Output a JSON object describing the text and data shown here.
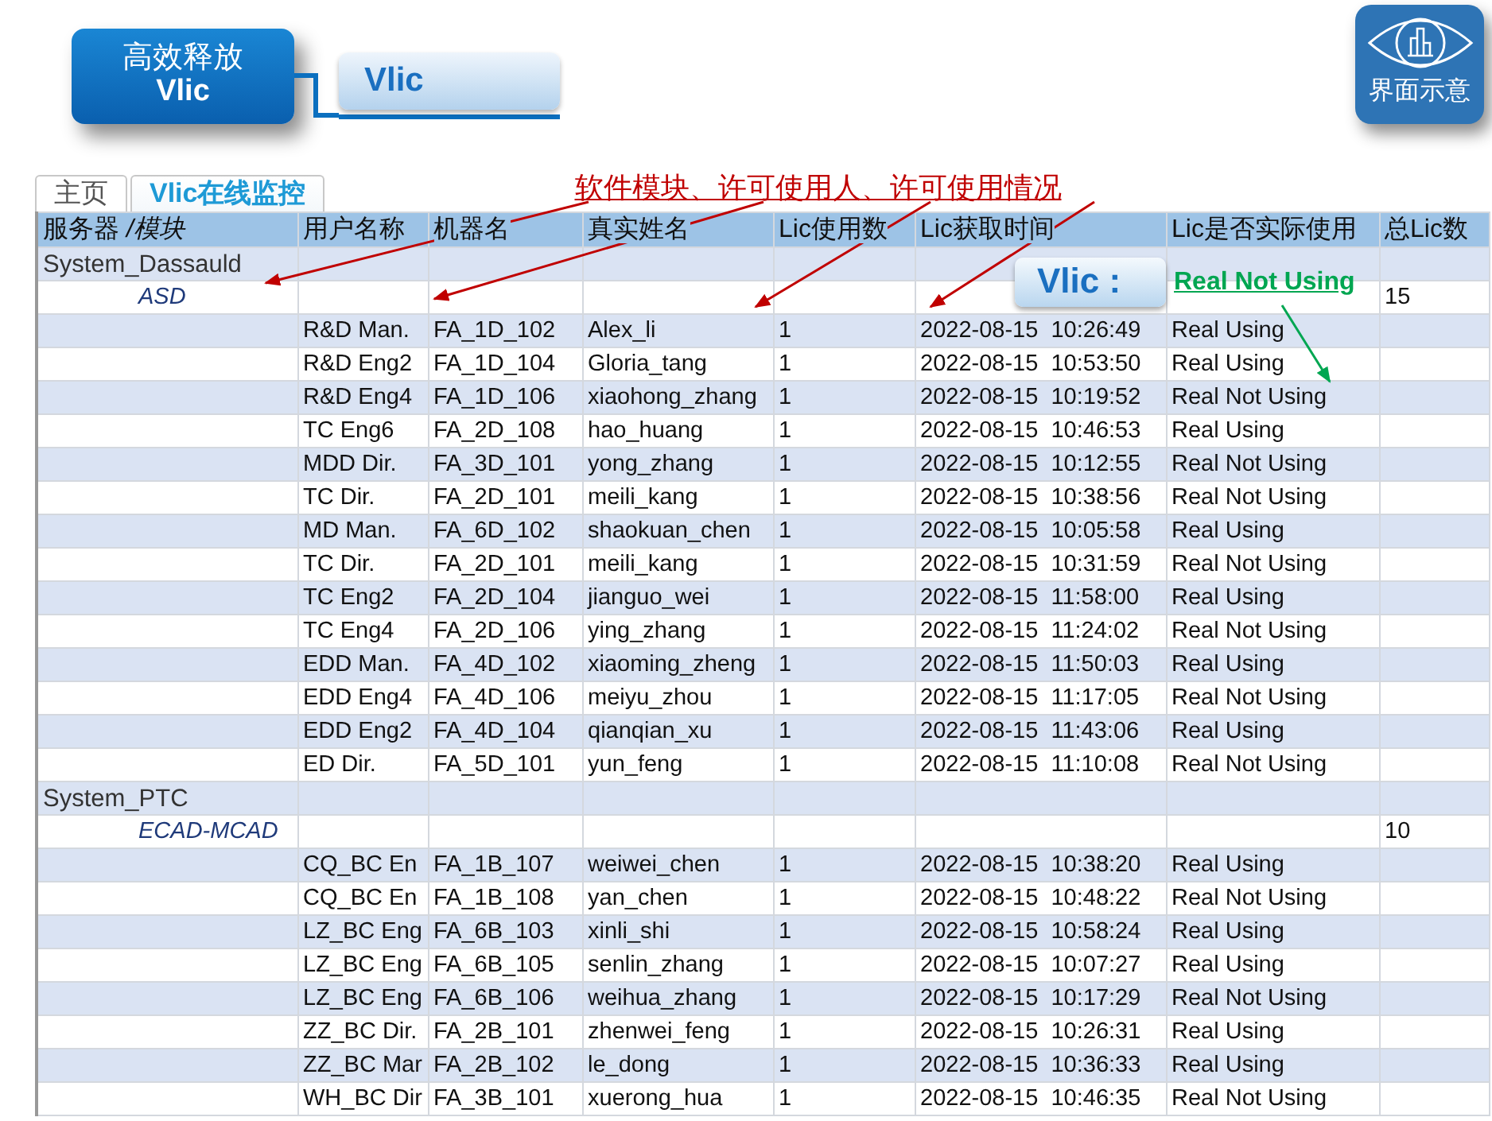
{
  "header": {
    "title_lines": [
      "高效释放",
      "Vlic"
    ],
    "subtitle": "Vlic"
  },
  "badge": {
    "label": "界面示意"
  },
  "tabs": [
    {
      "label": "主页",
      "selected": false
    },
    {
      "label": "Vlic在线监控",
      "selected": true
    }
  ],
  "annotation": {
    "text": "软件模块、许可使用人、许可使用情况"
  },
  "callout": {
    "label": "Vlic :",
    "note": "Real Not Using"
  },
  "table": {
    "columns": [
      "服务器 */模块*",
      "用户名称",
      "机器名",
      "真实姓名",
      "Lic使用数",
      "Lic获取时间",
      "Lic是否实际使用",
      "总Lic数"
    ],
    "rows": [
      {
        "kind": "server",
        "name": "System_Dassauld"
      },
      {
        "kind": "module",
        "name": "ASD",
        "total": "15"
      },
      {
        "kind": "entry",
        "cells": [
          "R&D Man.",
          "FA_1D_102",
          "Alex_li",
          "1",
          "2022-08-15  10:26:49",
          "Real Using"
        ]
      },
      {
        "kind": "entry",
        "cells": [
          "R&D Eng2",
          "FA_1D_104",
          "Gloria_tang",
          "1",
          "2022-08-15  10:53:50",
          "Real Using"
        ]
      },
      {
        "kind": "entry",
        "cells": [
          "R&D Eng4",
          "FA_1D_106",
          "xiaohong_zhang",
          "1",
          "2022-08-15  10:19:52",
          "Real Not Using"
        ]
      },
      {
        "kind": "entry",
        "cells": [
          "TC Eng6",
          "FA_2D_108",
          "hao_huang",
          "1",
          "2022-08-15  10:46:53",
          "Real Using"
        ]
      },
      {
        "kind": "entry",
        "cells": [
          "MDD Dir.",
          "FA_3D_101",
          "yong_zhang",
          "1",
          "2022-08-15  10:12:55",
          "Real Not Using"
        ]
      },
      {
        "kind": "entry",
        "cells": [
          "TC Dir.",
          "FA_2D_101",
          "meili_kang",
          "1",
          "2022-08-15  10:38:56",
          "Real Not Using"
        ]
      },
      {
        "kind": "entry",
        "cells": [
          "MD Man.",
          "FA_6D_102",
          "shaokuan_chen",
          "1",
          "2022-08-15  10:05:58",
          "Real Using"
        ]
      },
      {
        "kind": "entry",
        "cells": [
          "TC Dir.",
          "FA_2D_101",
          "meili_kang",
          "1",
          "2022-08-15  10:31:59",
          "Real Not Using"
        ]
      },
      {
        "kind": "entry",
        "cells": [
          "TC Eng2",
          "FA_2D_104",
          "jianguo_wei",
          "1",
          "2022-08-15  11:58:00",
          "Real Using"
        ]
      },
      {
        "kind": "entry",
        "cells": [
          "TC Eng4",
          "FA_2D_106",
          "ying_zhang",
          "1",
          "2022-08-15  11:24:02",
          "Real Not Using"
        ]
      },
      {
        "kind": "entry",
        "cells": [
          "EDD Man.",
          "FA_4D_102",
          "xiaoming_zheng",
          "1",
          "2022-08-15  11:50:03",
          "Real Using"
        ]
      },
      {
        "kind": "entry",
        "cells": [
          "EDD Eng4",
          "FA_4D_106",
          "meiyu_zhou",
          "1",
          "2022-08-15  11:17:05",
          "Real Not Using"
        ]
      },
      {
        "kind": "entry",
        "cells": [
          "EDD Eng2",
          "FA_4D_104",
          "qianqian_xu",
          "1",
          "2022-08-15  11:43:06",
          "Real Using"
        ]
      },
      {
        "kind": "entry",
        "cells": [
          "ED Dir.",
          "FA_5D_101",
          "yun_feng",
          "1",
          "2022-08-15  11:10:08",
          "Real Not Using"
        ]
      },
      {
        "kind": "server",
        "name": "System_PTC"
      },
      {
        "kind": "module",
        "name": "ECAD-MCAD",
        "total": "10"
      },
      {
        "kind": "entry",
        "cells": [
          "CQ_BC En",
          "FA_1B_107",
          "weiwei_chen",
          "1",
          "2022-08-15  10:38:20",
          "Real Using"
        ]
      },
      {
        "kind": "entry",
        "cells": [
          "CQ_BC En",
          "FA_1B_108",
          "yan_chen",
          "1",
          "2022-08-15  10:48:22",
          "Real Not Using"
        ]
      },
      {
        "kind": "entry",
        "cells": [
          "LZ_BC Eng",
          "FA_6B_103",
          "xinli_shi",
          "1",
          "2022-08-15  10:58:24",
          "Real Using"
        ]
      },
      {
        "kind": "entry",
        "cells": [
          "LZ_BC Eng",
          "FA_6B_105",
          "senlin_zhang",
          "1",
          "2022-08-15  10:07:27",
          "Real Using"
        ]
      },
      {
        "kind": "entry",
        "cells": [
          "LZ_BC Eng",
          "FA_6B_106",
          "weihua_zhang",
          "1",
          "2022-08-15  10:17:29",
          "Real Not Using"
        ]
      },
      {
        "kind": "entry",
        "cells": [
          "ZZ_BC Dir.",
          "FA_2B_101",
          "zhenwei_feng",
          "1",
          "2022-08-15  10:26:31",
          "Real Using"
        ]
      },
      {
        "kind": "entry",
        "cells": [
          "ZZ_BC Mar",
          "FA_2B_102",
          "le_dong",
          "1",
          "2022-08-15  10:36:33",
          "Real Using"
        ]
      },
      {
        "kind": "entry",
        "cells": [
          "WH_BC Dir",
          "FA_3B_101",
          "xuerong_hua",
          "1",
          "2022-08-15  10:46:35",
          "Real Not Using"
        ]
      }
    ]
  }
}
